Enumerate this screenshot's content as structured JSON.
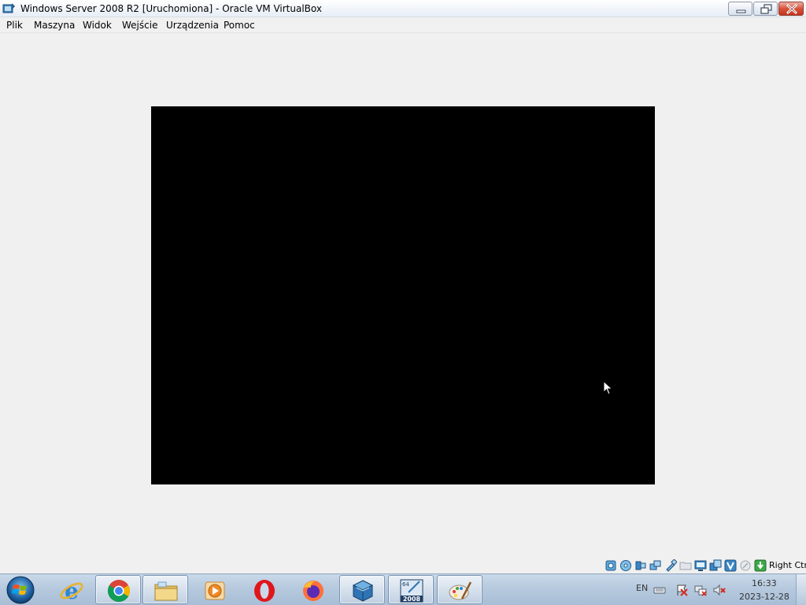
{
  "window": {
    "title": "Windows Server 2008 R2 [Uruchomiona] - Oracle VM VirtualBox",
    "app_icon": "virtualbox-icon",
    "controls": [
      "minimize-icon",
      "restore-icon",
      "close-icon"
    ]
  },
  "menubar": {
    "items": [
      {
        "label": "Plik"
      },
      {
        "label": "Maszyna"
      },
      {
        "label": "Widok"
      },
      {
        "label": "Wejście"
      },
      {
        "label": "Urządzenia"
      },
      {
        "label": "Pomoc"
      }
    ]
  },
  "vm_display": {
    "screen_color": "#000000",
    "cursor": "mouse-pointer-icon"
  },
  "status_bar": {
    "icons": [
      "hard-disk-icon",
      "optical-drive-icon",
      "audio-icon",
      "network-icon",
      "usb-icon",
      "shared-folders-icon",
      "display-icon",
      "video-capture-icon",
      "virtualization-icon",
      "mouse-integration-icon",
      "keyboard-capture-icon"
    ],
    "host_key": "Right Ctrl"
  },
  "taskbar": {
    "start": "windows-start-icon",
    "buttons": [
      {
        "name": "internet-explorer-icon",
        "active": false
      },
      {
        "name": "chrome-icon",
        "active": true
      },
      {
        "name": "file-explorer-icon",
        "active": true
      },
      {
        "name": "media-player-icon",
        "active": false
      },
      {
        "name": "opera-icon",
        "active": false
      },
      {
        "name": "firefox-icon",
        "active": false
      },
      {
        "name": "virtualbox-icon",
        "active": true
      },
      {
        "name": "windows-server-2008-icon",
        "active": true,
        "label": "2008",
        "badge": "64"
      },
      {
        "name": "paint-icon",
        "active": true
      }
    ],
    "tray": {
      "language": "EN",
      "icons": [
        "keyboard-icon",
        "action-center-flag-icon",
        "network-error-icon",
        "volume-muted-icon"
      ],
      "time": "16:33",
      "date": "2023-12-28"
    }
  }
}
